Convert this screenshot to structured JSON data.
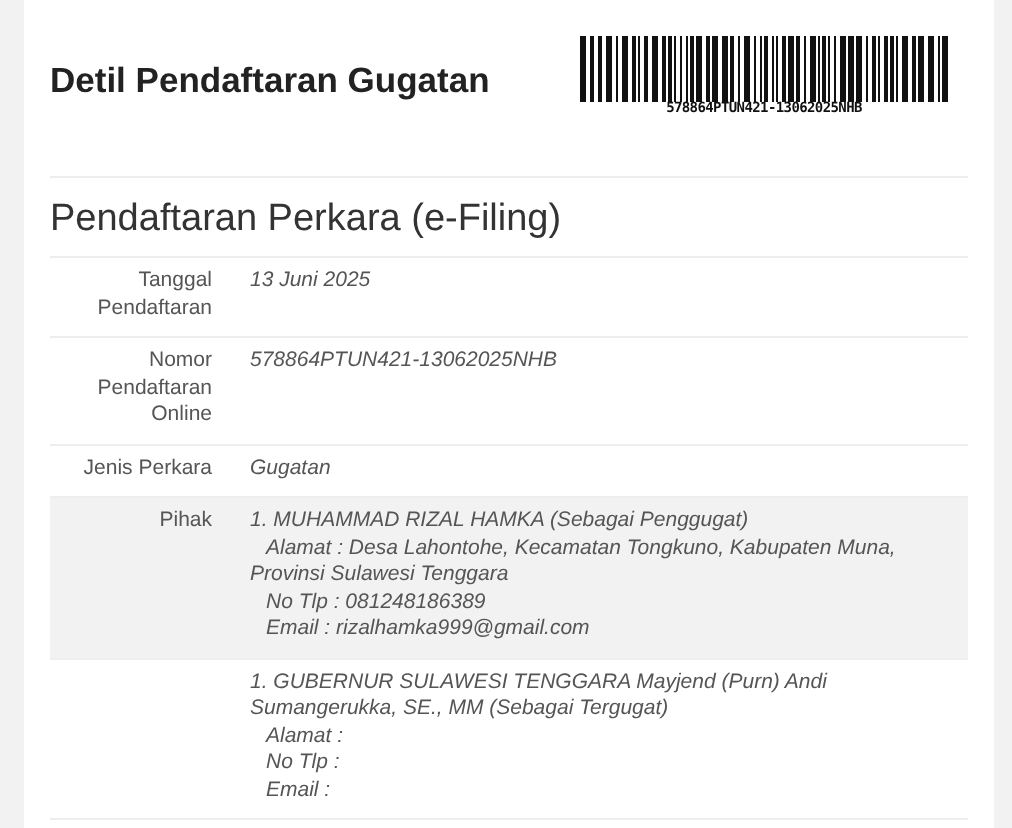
{
  "header": {
    "title": "Detil Pendaftaran Gugatan",
    "barcode_text": "578864PTUN421-13062025NHB"
  },
  "section": {
    "title": "Pendaftaran Perkara (e-Filing)"
  },
  "rows": [
    {
      "kind": "text",
      "label": "Tanggal Pendaftaran",
      "value": "13 Juni 2025",
      "highlighted": false
    },
    {
      "kind": "text",
      "label": "Nomor Pendaftaran Online",
      "value": "578864PTUN421-13062025NHB",
      "highlighted": false
    },
    {
      "kind": "text",
      "label": "Jenis Perkara",
      "value": "Gugatan",
      "highlighted": false
    },
    {
      "kind": "party",
      "label": "Pihak",
      "name": "1. MUHAMMAD RIZAL HAMKA (Sebagai Penggugat)",
      "address": "Alamat : Desa Lahontohe, Kecamatan Tongkuno, Kabupaten Muna, Provinsi Sulawesi Tenggara",
      "phone": "No Tlp : 081248186389",
      "email": "Email : rizalhamka999@gmail.com",
      "highlighted": true
    },
    {
      "kind": "party",
      "name": "1. GUBERNUR SULAWESI TENGGARA Mayjend (Purn) Andi Sumangerukka, SE., MM (Sebagai Tergugat)",
      "address": "Alamat :",
      "phone": "No Tlp :",
      "email": "Email :",
      "highlighted": false
    }
  ]
}
